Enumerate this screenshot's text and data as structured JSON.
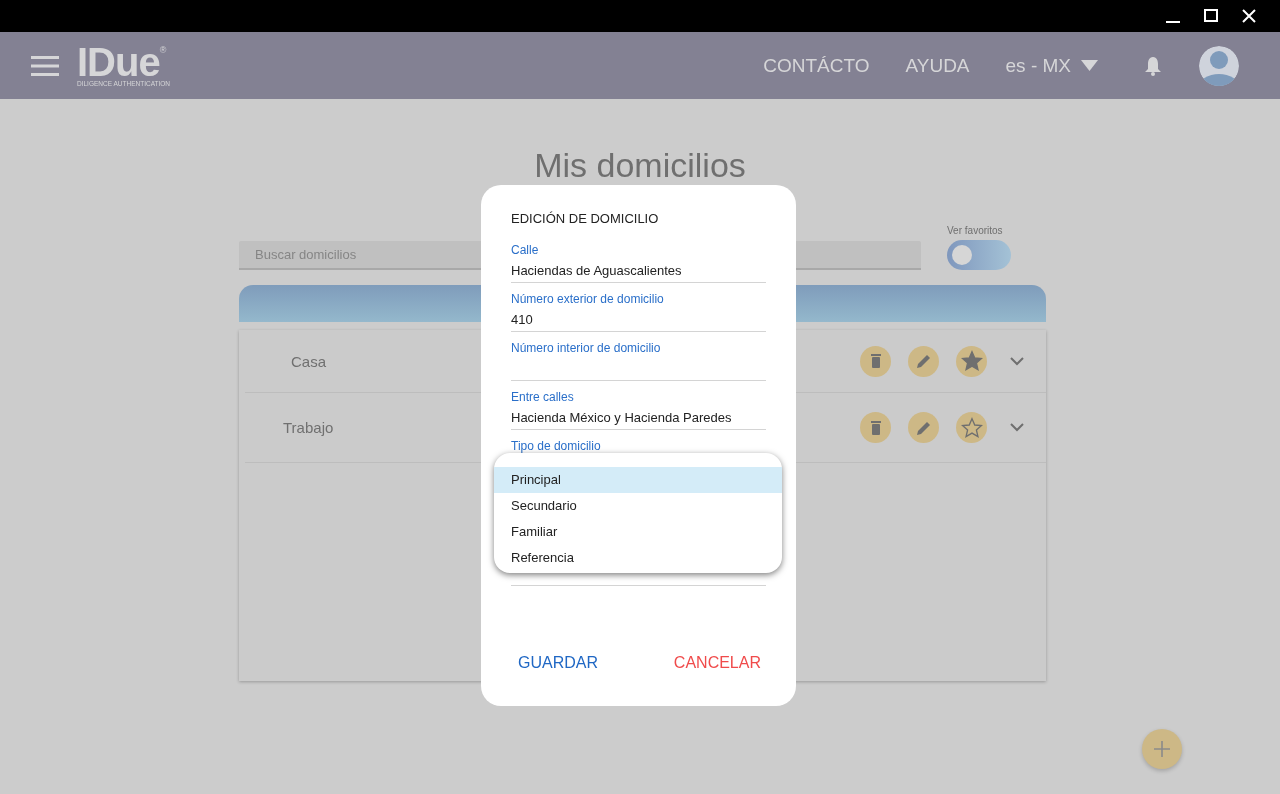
{
  "header": {
    "logo": "IDue",
    "logo_mark": "®",
    "logo_tagline": "DILIGENCE AUTHENTICATION",
    "nav": [
      "CONTÁCTO",
      "AYUDA"
    ],
    "language": "es - MX"
  },
  "page": {
    "title": "Mis domicilios",
    "search": {
      "placeholder": "Buscar domicilios"
    },
    "favorites_toggle": {
      "label": "Ver favoritos",
      "on": false
    },
    "addresses": [
      {
        "name": "Casa",
        "favorite": true
      },
      {
        "name": "Trabajo",
        "favorite": false
      }
    ]
  },
  "dialog": {
    "title": "EDICIÓN DE DOMICILIO",
    "fields": [
      {
        "label": "Calle",
        "value": "Haciendas de Aguascalientes"
      },
      {
        "label": "Número exterior de domicilio",
        "value": "410"
      },
      {
        "label": "Número interior de domicilio"
      },
      {
        "label": "Entre calles",
        "value": "Hacienda México y Hacienda Paredes"
      },
      {
        "label": "Tipo de domicilio"
      }
    ],
    "options": [
      {
        "label": "Principal",
        "selected": true
      },
      {
        "label": "Secundario",
        "selected": false
      },
      {
        "label": "Familiar",
        "selected": false
      },
      {
        "label": "Referencia",
        "selected": false
      }
    ],
    "buttons": [
      {
        "label": "GUARDAR",
        "kind": "primary"
      },
      {
        "label": "CANCELAR",
        "kind": "danger"
      }
    ]
  }
}
